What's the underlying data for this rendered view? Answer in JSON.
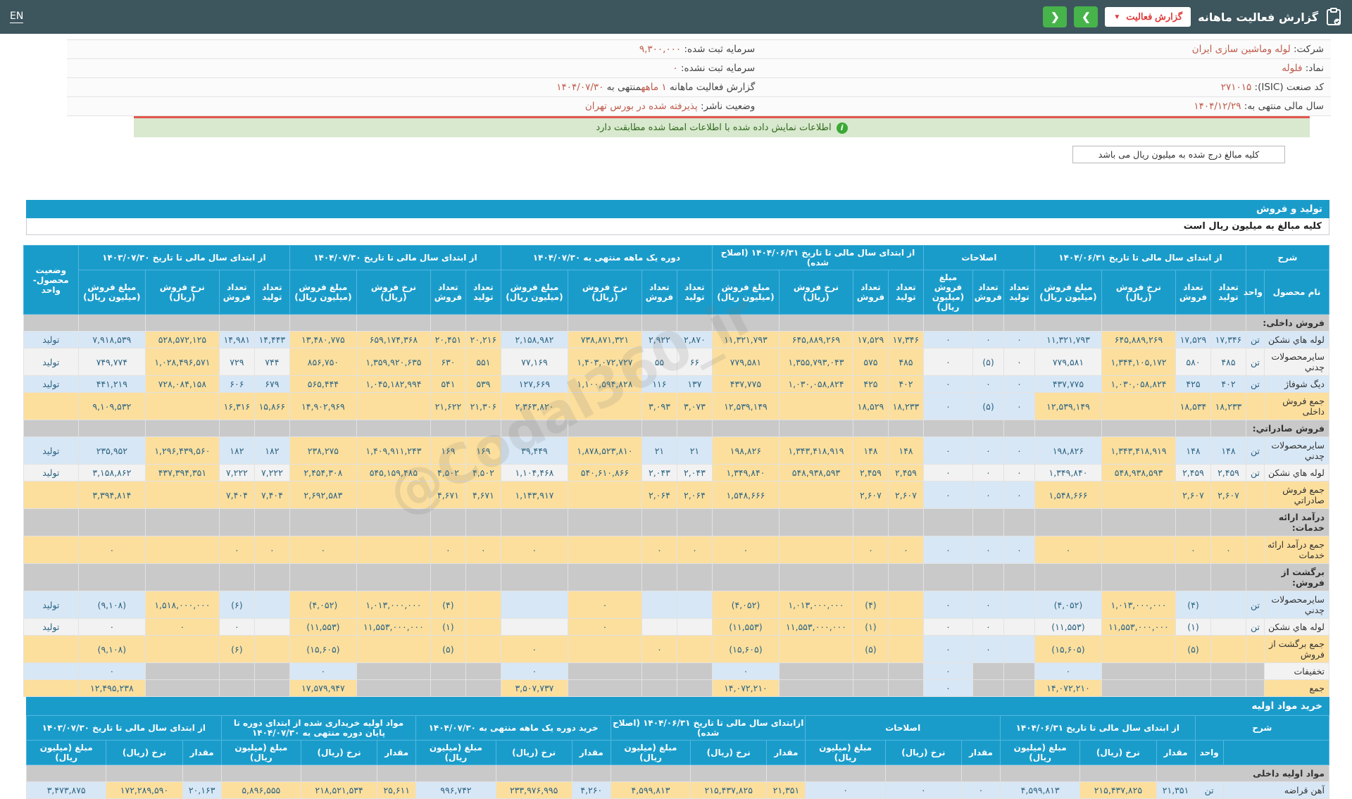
{
  "topbar": {
    "title": "گزارش فعالیت ماهانه",
    "report_button": "گزارش فعالیت",
    "prev_label": "❮",
    "next_label": "❯",
    "en": "EN"
  },
  "colors": {
    "topbar_bg": "#3d555d",
    "accent_blue": "#1a9ccb",
    "green_button": "#47b34b",
    "highlight_yellow": "#fcdf9d",
    "highlight_blue": "#d8e7f5",
    "section_gray": "#c9c9c9",
    "negative_red": "#e23c39",
    "value_orange": "#bf5b4b"
  },
  "watermark": "@Codal360_ir",
  "info": {
    "rows": [
      [
        [
          {
            "t": "شرکت:  ",
            "c": "n"
          },
          {
            "t": "لوله وماشین سازی ایران",
            "c": "v"
          }
        ],
        [
          {
            "t": "سرمایه ثبت شده:  ",
            "c": "n"
          },
          {
            "t": "۹,۳۰۰,۰۰۰",
            "c": "v"
          }
        ]
      ],
      [
        [
          {
            "t": "نماد:  ",
            "c": "n"
          },
          {
            "t": "فلوله",
            "c": "v"
          }
        ],
        [
          {
            "t": "سرمایه ثبت نشده:  ",
            "c": "n"
          },
          {
            "t": "۰",
            "c": "v"
          }
        ]
      ],
      [
        [
          {
            "t": "کد صنعت (ISIC):  ",
            "c": "n"
          },
          {
            "t": "۲۷۱۰۱۵",
            "c": "v"
          }
        ],
        [
          {
            "t": "گزارش فعالیت ماهانه ",
            "c": "n"
          },
          {
            "t": "۱ ماهه",
            "c": "v"
          },
          {
            "t": "منتهی به ",
            "c": "n"
          },
          {
            "t": "۱۴۰۴/۰۷/۳۰",
            "c": "v"
          }
        ]
      ],
      [
        [
          {
            "t": "سال مالی منتهی به:  ",
            "c": "n"
          },
          {
            "t": "۱۴۰۴/۱۲/۲۹",
            "c": "v"
          }
        ],
        [
          {
            "t": "وضعیت ناشر:  ",
            "c": "n"
          },
          {
            "t": "پذیرفته شده در بورس تهران",
            "c": "v"
          }
        ]
      ]
    ]
  },
  "notice": "اطلاعات نمایش داده شده با اطلاعات امضا شده مطابقت دارد",
  "unit_note": "کلیه مبالغ درج شده به میلیون ریال می باشد",
  "sales_section": {
    "title": "تولید و فروش",
    "subtitle": "کلیه مبالغ به میلیون ریال است",
    "header": {
      "sharh": "شرح",
      "name": "نام محصول",
      "unit": "واحد",
      "status": "وضعیت محصول-واحد",
      "subcols4": [
        "تعداد تولید",
        "تعداد فروش",
        "نرخ فروش (ریال)",
        "مبلغ فروش (میلیون ریال)"
      ],
      "subcols3": [
        "تعداد تولید",
        "تعداد فروش",
        "مبلغ فروش (میلیون ریال)"
      ],
      "groups": [
        "از ابتدای سال مالی تا تاریخ ۱۴۰۴/۰۶/۳۱",
        "اصلاحات",
        "از ابتدای سال مالی تا تاریخ ۱۴۰۴/۰۶/۳۱ (اصلاح شده)",
        "دوره یک ماهه منتهی به ۱۴۰۴/۰۷/۳۰",
        "از ابتدای سال مالی تا تاریخ ۱۴۰۴/۰۷/۳۰",
        "از ابتدای سال مالی تا تاریخ ۱۴۰۳/۰۷/۳۰"
      ]
    },
    "rows": [
      {
        "type": "section",
        "name": "فروش داخلی:"
      },
      {
        "type": "product",
        "shade": "b",
        "name": "لوله هاي نشكن",
        "unit": "تن",
        "status": "تولید",
        "g2": [
          "۱۷,۳۴۶",
          "۱۷,۵۲۹",
          "۶۴۵,۸۸۹,۲۶۹",
          "۱۱,۳۲۱,۷۹۳"
        ],
        "g3": [
          "۰",
          "۰",
          "۰"
        ],
        "g4": [
          "۱۷,۳۴۶",
          "۱۷,۵۲۹",
          "۶۴۵,۸۸۹,۲۶۹",
          "۱۱,۳۲۱,۷۹۳"
        ],
        "g5": [
          "۲,۸۷۰",
          "۲,۹۲۲",
          "۷۳۸,۸۷۱,۳۲۱",
          "۲,۱۵۸,۹۸۲"
        ],
        "g6": [
          "۲۰,۲۱۶",
          "۲۰,۴۵۱",
          "۶۵۹,۱۷۴,۳۶۸",
          "۱۳,۴۸۰,۷۷۵"
        ],
        "g7": [
          "۱۴,۴۴۳",
          "۱۴,۹۸۱",
          "۵۲۸,۵۷۲,۱۲۵",
          "۷,۹۱۸,۵۳۹"
        ]
      },
      {
        "type": "product",
        "shade": "w",
        "name": "سايرمحصولات چدني",
        "unit": "تن",
        "status": "تولید",
        "g2": [
          "۴۸۵",
          "۵۸۰",
          "۱,۳۴۴,۱۰۵,۱۷۲",
          "۷۷۹,۵۸۱"
        ],
        "g3": [
          "۰",
          "(۵)",
          "۰"
        ],
        "g4": [
          "۴۸۵",
          "۵۷۵",
          "۱,۳۵۵,۷۹۳,۰۴۳",
          "۷۷۹,۵۸۱"
        ],
        "g5": [
          "۶۶",
          "۵۵",
          "۱,۴۰۳,۰۷۲,۷۲۷",
          "۷۷,۱۶۹"
        ],
        "g6": [
          "۵۵۱",
          "۶۳۰",
          "۱,۳۵۹,۹۲۰,۶۳۵",
          "۸۵۶,۷۵۰"
        ],
        "g7": [
          "۷۴۴",
          "۷۲۹",
          "۱,۰۲۸,۴۹۶,۵۷۱",
          "۷۴۹,۷۷۴"
        ]
      },
      {
        "type": "product",
        "shade": "b",
        "name": "ديگ شوفاژ",
        "unit": "تن",
        "status": "تولید",
        "g2": [
          "۴۰۲",
          "۴۲۵",
          "۱,۰۳۰,۰۵۸,۸۲۴",
          "۴۳۷,۷۷۵"
        ],
        "g3": [
          "۰",
          "۰",
          "۰"
        ],
        "g4": [
          "۴۰۲",
          "۴۲۵",
          "۱,۰۳۰,۰۵۸,۸۲۴",
          "۴۳۷,۷۷۵"
        ],
        "g5": [
          "۱۳۷",
          "۱۱۶",
          "۱,۱۰۰,۵۹۴,۸۲۸",
          "۱۲۷,۶۶۹"
        ],
        "g6": [
          "۵۳۹",
          "۵۴۱",
          "۱,۰۴۵,۱۸۲,۹۹۴",
          "۵۶۵,۴۴۴"
        ],
        "g7": [
          "۶۷۹",
          "۶۰۶",
          "۷۲۸,۰۸۴,۱۵۸",
          "۴۴۱,۲۱۹"
        ]
      },
      {
        "type": "total",
        "name": "جمع فروش داخلی",
        "g2": [
          "۱۸,۲۳۳",
          "۱۸,۵۳۴",
          "",
          "۱۲,۵۳۹,۱۴۹"
        ],
        "g3": [
          "۰",
          "(۵)",
          "۰"
        ],
        "g4": [
          "۱۸,۲۳۳",
          "۱۸,۵۲۹",
          "",
          "۱۲,۵۳۹,۱۴۹"
        ],
        "g5": [
          "۳,۰۷۳",
          "۳,۰۹۳",
          "",
          "۲,۳۶۳,۸۲۰"
        ],
        "g6": [
          "۲۱,۳۰۶",
          "۲۱,۶۲۲",
          "",
          "۱۴,۹۰۲,۹۶۹"
        ],
        "g7": [
          "۱۵,۸۶۶",
          "۱۶,۳۱۶",
          "",
          "۹,۱۰۹,۵۳۲"
        ]
      },
      {
        "type": "section",
        "name": "فروش صادراتي:"
      },
      {
        "type": "product",
        "shade": "b",
        "name": "سايرمحصولات چدني",
        "unit": "تن",
        "status": "تولید",
        "g2": [
          "۱۴۸",
          "۱۴۸",
          "۱,۳۴۳,۴۱۸,۹۱۹",
          "۱۹۸,۸۲۶"
        ],
        "g3": [
          "۰",
          "۰",
          "۰"
        ],
        "g4": [
          "۱۴۸",
          "۱۴۸",
          "۱,۳۴۳,۴۱۸,۹۱۹",
          "۱۹۸,۸۲۶"
        ],
        "g5": [
          "۲۱",
          "۲۱",
          "۱,۸۷۸,۵۲۳,۸۱۰",
          "۳۹,۴۴۹"
        ],
        "g6": [
          "۱۶۹",
          "۱۶۹",
          "۱,۴۰۹,۹۱۱,۲۴۳",
          "۲۳۸,۲۷۵"
        ],
        "g7": [
          "۱۸۲",
          "۱۸۲",
          "۱,۲۹۶,۴۳۹,۵۶۰",
          "۲۳۵,۹۵۲"
        ]
      },
      {
        "type": "product",
        "shade": "w",
        "name": "لوله هاي نشكن",
        "unit": "تن",
        "status": "تولید",
        "g2": [
          "۲,۴۵۹",
          "۲,۴۵۹",
          "۵۴۸,۹۳۸,۵۹۳",
          "۱,۳۴۹,۸۴۰"
        ],
        "g3": [
          "۰",
          "۰",
          "۰"
        ],
        "g4": [
          "۲,۴۵۹",
          "۲,۴۵۹",
          "۵۴۸,۹۳۸,۵۹۳",
          "۱,۳۴۹,۸۴۰"
        ],
        "g5": [
          "۲,۰۴۳",
          "۲,۰۴۳",
          "۵۴۰,۶۱۰,۸۶۶",
          "۱,۱۰۴,۴۶۸"
        ],
        "g6": [
          "۴,۵۰۲",
          "۴,۵۰۲",
          "۵۴۵,۱۵۹,۴۸۵",
          "۲,۴۵۴,۳۰۸"
        ],
        "g7": [
          "۷,۲۲۲",
          "۷,۲۲۲",
          "۴۳۷,۳۹۴,۳۵۱",
          "۳,۱۵۸,۸۶۲"
        ]
      },
      {
        "type": "total",
        "name": "جمع فروش صادراتي",
        "g2": [
          "۲,۶۰۷",
          "۲,۶۰۷",
          "",
          "۱,۵۴۸,۶۶۶"
        ],
        "g3": [
          "۰",
          "۰",
          "۰"
        ],
        "g4": [
          "۲,۶۰۷",
          "۲,۶۰۷",
          "",
          "۱,۵۴۸,۶۶۶"
        ],
        "g5": [
          "۲,۰۶۴",
          "۲,۰۶۴",
          "",
          "۱,۱۴۳,۹۱۷"
        ],
        "g6": [
          "۴,۶۷۱",
          "۴,۶۷۱",
          "",
          "۲,۶۹۲,۵۸۳"
        ],
        "g7": [
          "۷,۴۰۴",
          "۷,۴۰۴",
          "",
          "۳,۳۹۴,۸۱۴"
        ]
      },
      {
        "type": "section",
        "name": "درآمد ارائه خدمات:"
      },
      {
        "type": "total",
        "name": "جمع درآمد ارائه خدمات",
        "g2": [
          "۰",
          "۰",
          "",
          "۰"
        ],
        "g3": [
          "۰",
          "۰",
          "۰"
        ],
        "g4": [
          "۰",
          "۰",
          "",
          "۰"
        ],
        "g5": [
          "۰",
          "۰",
          "",
          "۰"
        ],
        "g6": [
          "۰",
          "۰",
          "",
          "۰"
        ],
        "g7": [
          "۰",
          "۰",
          "",
          "۰"
        ]
      },
      {
        "type": "section",
        "name": "برگشت از فروش:"
      },
      {
        "type": "product",
        "shade": "b",
        "name": "سايرمحصولات چدني",
        "unit": "تن",
        "status": "تولید",
        "g2": [
          "",
          "(۴)",
          "۱,۰۱۳,۰۰۰,۰۰۰",
          "(۴,۰۵۲)"
        ],
        "g3": [
          "",
          "۰",
          "۰"
        ],
        "g4": [
          "",
          "(۴)",
          "۱,۰۱۳,۰۰۰,۰۰۰",
          "(۴,۰۵۲)"
        ],
        "g5": [
          "",
          "",
          "۰",
          ""
        ],
        "g6": [
          "",
          "(۴)",
          "۱,۰۱۳,۰۰۰,۰۰۰",
          "(۴,۰۵۲)"
        ],
        "g7": [
          "",
          "(۶)",
          "۱,۵۱۸,۰۰۰,۰۰۰",
          "(۹,۱۰۸)"
        ]
      },
      {
        "type": "product",
        "shade": "w",
        "name": "لوله هاي نشكن",
        "unit": "تن",
        "status": "تولید",
        "g2": [
          "",
          "(۱)",
          "۱۱,۵۵۳,۰۰۰,۰۰۰",
          "(۱۱,۵۵۳)"
        ],
        "g3": [
          "",
          "۰",
          "۰"
        ],
        "g4": [
          "",
          "(۱)",
          "۱۱,۵۵۳,۰۰۰,۰۰۰",
          "(۱۱,۵۵۳)"
        ],
        "g5": [
          "",
          "",
          "۰",
          ""
        ],
        "g6": [
          "",
          "(۱)",
          "۱۱,۵۵۳,۰۰۰,۰۰۰",
          "(۱۱,۵۵۳)"
        ],
        "g7": [
          "",
          "۰",
          "۰",
          "۰"
        ]
      },
      {
        "type": "total",
        "name": "جمع برگشت از فروش",
        "g2": [
          "",
          "(۵)",
          "",
          "(۱۵,۶۰۵)"
        ],
        "g3": [
          "",
          "۰",
          "۰"
        ],
        "g4": [
          "",
          "(۵)",
          "",
          "(۱۵,۶۰۵)"
        ],
        "g5": [
          "",
          "۰",
          "",
          "۰"
        ],
        "g6": [
          "",
          "(۵)",
          "",
          "(۱۵,۶۰۵)"
        ],
        "g7": [
          "",
          "(۶)",
          "",
          "(۹,۱۰۸)"
        ]
      },
      {
        "type": "discount",
        "name": "تخفيفات",
        "g2": [
          "",
          "",
          "",
          "۰"
        ],
        "g3": [
          "",
          "",
          "۰"
        ],
        "g4": [
          "",
          "",
          "",
          "۰"
        ],
        "g5": [
          "",
          "",
          "",
          "۰"
        ],
        "g6": [
          "",
          "",
          "",
          "۰"
        ],
        "g7": [
          "",
          "",
          "",
          "۰"
        ]
      },
      {
        "type": "grand",
        "name": "جمع",
        "g2": [
          "",
          "",
          "",
          "۱۴,۰۷۲,۲۱۰"
        ],
        "g3": [
          "",
          "",
          "۰"
        ],
        "g4": [
          "",
          "",
          "",
          "۱۴,۰۷۲,۲۱۰"
        ],
        "g5": [
          "",
          "",
          "",
          "۳,۵۰۷,۷۳۷"
        ],
        "g6": [
          "",
          "",
          "",
          "۱۷,۵۷۹,۹۴۷"
        ],
        "g7": [
          "",
          "",
          "",
          "۱۲,۴۹۵,۲۳۸"
        ]
      }
    ]
  },
  "materials_section": {
    "title": "خرید مواد اولیه",
    "header": {
      "sharh": "شرح",
      "unit": "واحد",
      "subcols": [
        "مقدار",
        "نرخ (ریال)",
        "مبلغ (میلیون ریال)"
      ],
      "groups": [
        "از ابتدای سال مالی تا تاریخ ۱۴۰۴/۰۶/۳۱",
        "اصلاحات",
        "ازابتدای سال مالی تا تاریخ ۱۴۰۴/۰۶/۳۱ (اصلاح شده)",
        "خرید دوره یک ماهه منتهی به ۱۴۰۴/۰۷/۳۰",
        "مواد اولیه خریداری شده از ابتدای دوره تا پایان دوره منتهی به ۱۴۰۴/۰۷/۳۰",
        "از ابتدای سال مالی تا تاریخ ۱۴۰۳/۰۷/۳۰"
      ]
    },
    "rows": [
      {
        "type": "section",
        "name": "مواد اولیه داخلی"
      },
      {
        "type": "product",
        "shade": "b",
        "name": "آهن قراضه",
        "unit": "تن",
        "g2": [
          "۲۱,۳۵۱",
          "۲۱۵,۴۳۷,۸۲۵",
          "۴,۵۹۹,۸۱۳"
        ],
        "g3": [
          "۰",
          "۰",
          "۰"
        ],
        "g4": [
          "۲۱,۳۵۱",
          "۲۱۵,۴۳۷,۸۲۵",
          "۴,۵۹۹,۸۱۳"
        ],
        "g5": [
          "۴,۲۶۰",
          "۲۳۳,۹۷۶,۹۹۵",
          "۹۹۶,۷۴۲"
        ],
        "g6": [
          "۲۵,۶۱۱",
          "۲۱۸,۵۲۱,۵۳۴",
          "۵,۸۹۶,۵۵۵"
        ],
        "g7": [
          "۲۰,۱۶۳",
          "۱۷۲,۲۸۹,۵۹۰",
          "۳,۴۷۳,۸۷۵"
        ]
      }
    ]
  }
}
